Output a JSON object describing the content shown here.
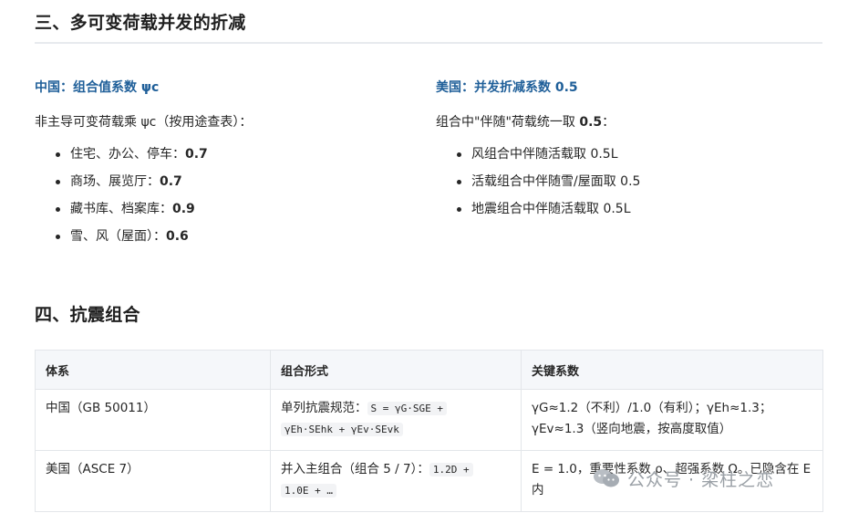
{
  "section3": {
    "heading": "三、多可变荷载并发的折减",
    "china": {
      "title": "中国：组合值系数 ψc",
      "intro": "非主导可变荷载乘 ψc（按用途查表）：",
      "items": [
        {
          "label": "住宅、办公、停车：",
          "value": "0.7"
        },
        {
          "label": "商场、展览厅：",
          "value": "0.7"
        },
        {
          "label": "藏书库、档案库：",
          "value": "0.9"
        },
        {
          "label": "雪、风（屋面）：",
          "value": "0.6"
        }
      ]
    },
    "usa": {
      "title": "美国：并发折减系数 0.5",
      "intro_pre": "组合中\"伴随\"荷载统一取 ",
      "intro_value": "0.5",
      "intro_post": "：",
      "items": [
        "风组合中伴随活载取 0.5L",
        "活载组合中伴随雪/屋面取 0.5",
        "地震组合中伴随活载取 0.5L"
      ]
    }
  },
  "section4": {
    "heading": "四、抗震组合",
    "table": {
      "headers": [
        "体系",
        "组合形式",
        "关键系数"
      ],
      "rows": [
        {
          "system": "中国（GB 50011）",
          "form_text": "单列抗震规范：",
          "form_code_1": "S = γG·SGE +",
          "form_code_2": "γEh·SEhk + γEv·SEvk",
          "coeff_line1": "γG≈1.2（不利）/1.0（有利）；γEh≈1.3；",
          "coeff_line2": "γEv≈1.3（竖向地震，按高度取值）"
        },
        {
          "system": "美国（ASCE 7）",
          "form_text": "并入主组合（组合 5 / 7）：",
          "form_code_1": "1.2D +",
          "form_code_2": "1.0E + …",
          "coeff_line1": "E = 1.0，重要性系数 ρ、超强系数 Ω。已隐含在 E",
          "coeff_line2": "内"
        }
      ]
    }
  },
  "watermark": {
    "icon": "wechat-icon",
    "text": "公众号 · 梁柱之恋"
  }
}
